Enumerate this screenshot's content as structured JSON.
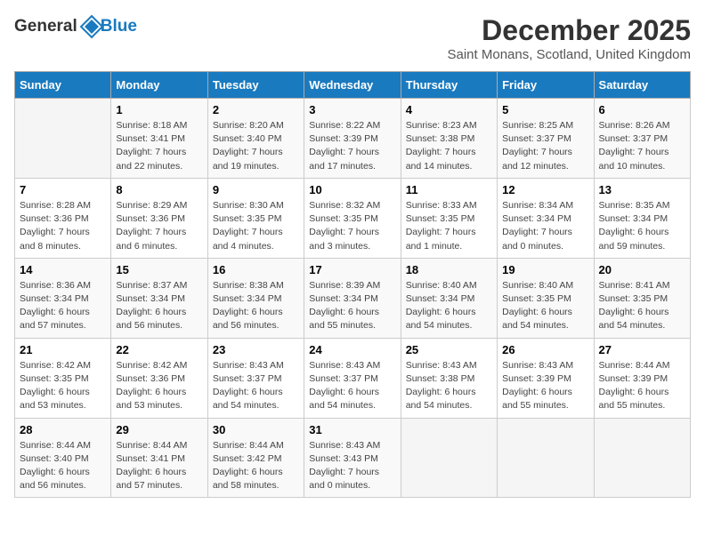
{
  "logo": {
    "text_general": "General",
    "text_blue": "Blue"
  },
  "header": {
    "month_year": "December 2025",
    "location": "Saint Monans, Scotland, United Kingdom"
  },
  "days_of_week": [
    "Sunday",
    "Monday",
    "Tuesday",
    "Wednesday",
    "Thursday",
    "Friday",
    "Saturday"
  ],
  "weeks": [
    [
      {
        "day": "",
        "detail": ""
      },
      {
        "day": "1",
        "detail": "Sunrise: 8:18 AM\nSunset: 3:41 PM\nDaylight: 7 hours\nand 22 minutes."
      },
      {
        "day": "2",
        "detail": "Sunrise: 8:20 AM\nSunset: 3:40 PM\nDaylight: 7 hours\nand 19 minutes."
      },
      {
        "day": "3",
        "detail": "Sunrise: 8:22 AM\nSunset: 3:39 PM\nDaylight: 7 hours\nand 17 minutes."
      },
      {
        "day": "4",
        "detail": "Sunrise: 8:23 AM\nSunset: 3:38 PM\nDaylight: 7 hours\nand 14 minutes."
      },
      {
        "day": "5",
        "detail": "Sunrise: 8:25 AM\nSunset: 3:37 PM\nDaylight: 7 hours\nand 12 minutes."
      },
      {
        "day": "6",
        "detail": "Sunrise: 8:26 AM\nSunset: 3:37 PM\nDaylight: 7 hours\nand 10 minutes."
      }
    ],
    [
      {
        "day": "7",
        "detail": "Sunrise: 8:28 AM\nSunset: 3:36 PM\nDaylight: 7 hours\nand 8 minutes."
      },
      {
        "day": "8",
        "detail": "Sunrise: 8:29 AM\nSunset: 3:36 PM\nDaylight: 7 hours\nand 6 minutes."
      },
      {
        "day": "9",
        "detail": "Sunrise: 8:30 AM\nSunset: 3:35 PM\nDaylight: 7 hours\nand 4 minutes."
      },
      {
        "day": "10",
        "detail": "Sunrise: 8:32 AM\nSunset: 3:35 PM\nDaylight: 7 hours\nand 3 minutes."
      },
      {
        "day": "11",
        "detail": "Sunrise: 8:33 AM\nSunset: 3:35 PM\nDaylight: 7 hours\nand 1 minute."
      },
      {
        "day": "12",
        "detail": "Sunrise: 8:34 AM\nSunset: 3:34 PM\nDaylight: 7 hours\nand 0 minutes."
      },
      {
        "day": "13",
        "detail": "Sunrise: 8:35 AM\nSunset: 3:34 PM\nDaylight: 6 hours\nand 59 minutes."
      }
    ],
    [
      {
        "day": "14",
        "detail": "Sunrise: 8:36 AM\nSunset: 3:34 PM\nDaylight: 6 hours\nand 57 minutes."
      },
      {
        "day": "15",
        "detail": "Sunrise: 8:37 AM\nSunset: 3:34 PM\nDaylight: 6 hours\nand 56 minutes."
      },
      {
        "day": "16",
        "detail": "Sunrise: 8:38 AM\nSunset: 3:34 PM\nDaylight: 6 hours\nand 56 minutes."
      },
      {
        "day": "17",
        "detail": "Sunrise: 8:39 AM\nSunset: 3:34 PM\nDaylight: 6 hours\nand 55 minutes."
      },
      {
        "day": "18",
        "detail": "Sunrise: 8:40 AM\nSunset: 3:34 PM\nDaylight: 6 hours\nand 54 minutes."
      },
      {
        "day": "19",
        "detail": "Sunrise: 8:40 AM\nSunset: 3:35 PM\nDaylight: 6 hours\nand 54 minutes."
      },
      {
        "day": "20",
        "detail": "Sunrise: 8:41 AM\nSunset: 3:35 PM\nDaylight: 6 hours\nand 54 minutes."
      }
    ],
    [
      {
        "day": "21",
        "detail": "Sunrise: 8:42 AM\nSunset: 3:35 PM\nDaylight: 6 hours\nand 53 minutes."
      },
      {
        "day": "22",
        "detail": "Sunrise: 8:42 AM\nSunset: 3:36 PM\nDaylight: 6 hours\nand 53 minutes."
      },
      {
        "day": "23",
        "detail": "Sunrise: 8:43 AM\nSunset: 3:37 PM\nDaylight: 6 hours\nand 54 minutes."
      },
      {
        "day": "24",
        "detail": "Sunrise: 8:43 AM\nSunset: 3:37 PM\nDaylight: 6 hours\nand 54 minutes."
      },
      {
        "day": "25",
        "detail": "Sunrise: 8:43 AM\nSunset: 3:38 PM\nDaylight: 6 hours\nand 54 minutes."
      },
      {
        "day": "26",
        "detail": "Sunrise: 8:43 AM\nSunset: 3:39 PM\nDaylight: 6 hours\nand 55 minutes."
      },
      {
        "day": "27",
        "detail": "Sunrise: 8:44 AM\nSunset: 3:39 PM\nDaylight: 6 hours\nand 55 minutes."
      }
    ],
    [
      {
        "day": "28",
        "detail": "Sunrise: 8:44 AM\nSunset: 3:40 PM\nDaylight: 6 hours\nand 56 minutes."
      },
      {
        "day": "29",
        "detail": "Sunrise: 8:44 AM\nSunset: 3:41 PM\nDaylight: 6 hours\nand 57 minutes."
      },
      {
        "day": "30",
        "detail": "Sunrise: 8:44 AM\nSunset: 3:42 PM\nDaylight: 6 hours\nand 58 minutes."
      },
      {
        "day": "31",
        "detail": "Sunrise: 8:43 AM\nSunset: 3:43 PM\nDaylight: 7 hours\nand 0 minutes."
      },
      {
        "day": "",
        "detail": ""
      },
      {
        "day": "",
        "detail": ""
      },
      {
        "day": "",
        "detail": ""
      }
    ]
  ]
}
